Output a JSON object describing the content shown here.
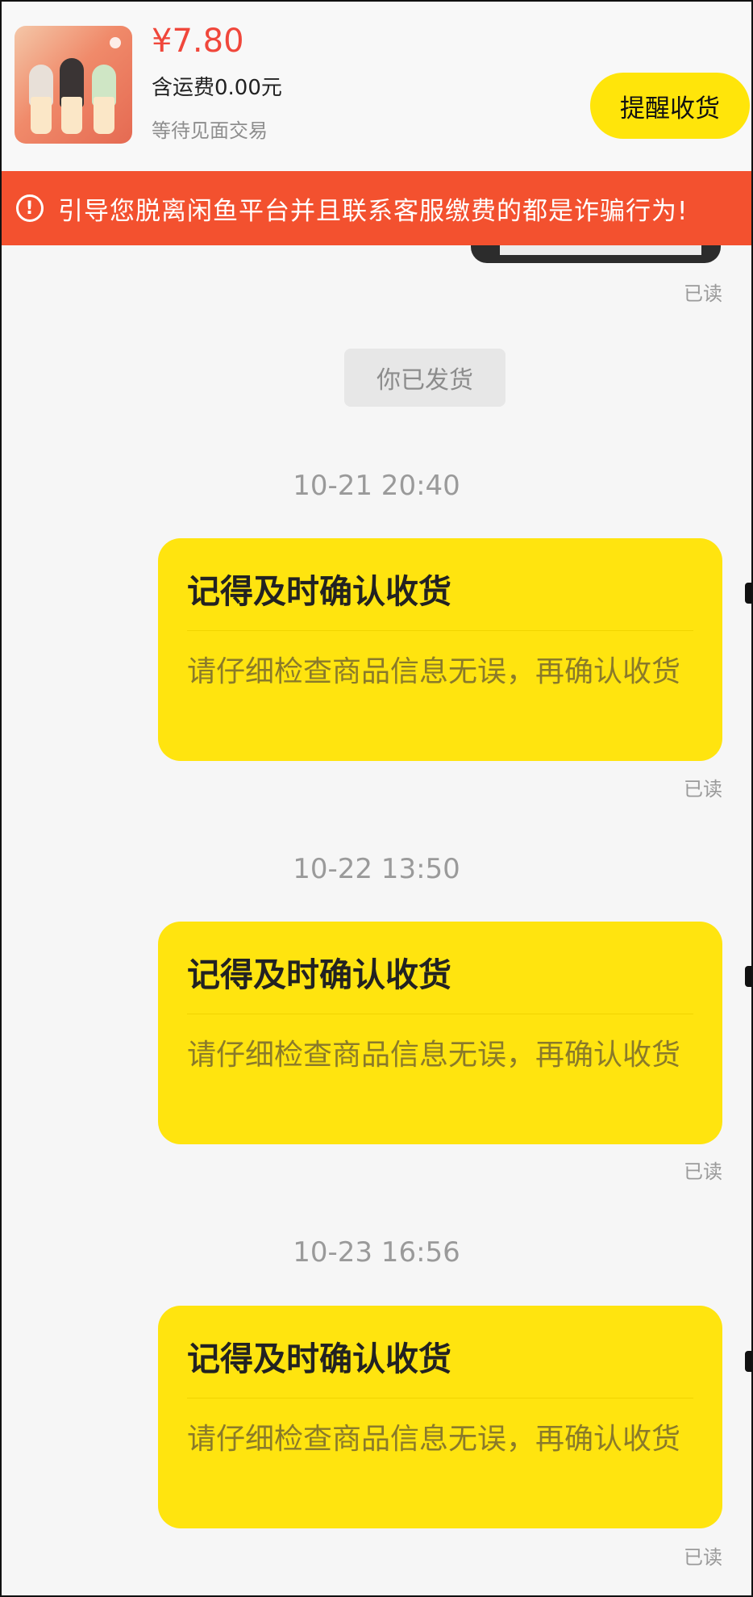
{
  "order": {
    "price": "¥7.80",
    "shipping": "含运费0.00元",
    "status": "等待见面交易",
    "remind_button": "提醒收货"
  },
  "warning": {
    "icon": "exclamation-circle-icon",
    "text": "引导您脱离闲鱼平台并且联系客服缴费的都是诈骗行为!"
  },
  "system_message": "你已发货",
  "messages": [
    {
      "timestamp": "10-21 20:40",
      "title": "记得及时确认收货",
      "body": "请仔细检查商品信息无误，再确认收货",
      "read": "已读"
    },
    {
      "timestamp": "10-22 13:50",
      "title": "记得及时确认收货",
      "body": "请仔细检查商品信息无误，再确认收货",
      "read": "已读"
    },
    {
      "timestamp": "10-23 16:56",
      "title": "记得及时确认收货",
      "body": "请仔细检查商品信息无误，再确认收货",
      "read": "已读"
    }
  ],
  "first_read": "已读",
  "colors": {
    "accent_yellow": "#ffe40f",
    "price_red": "#f0473b",
    "warning_red": "#f3512f"
  }
}
